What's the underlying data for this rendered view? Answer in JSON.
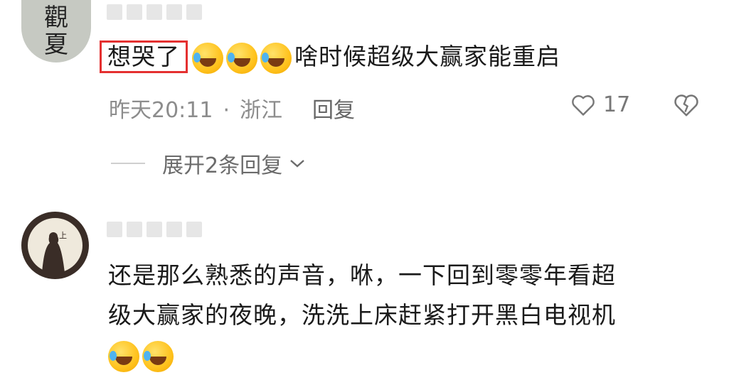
{
  "comments": [
    {
      "avatar_text": "觀夏",
      "highlighted_text": "想哭了",
      "emoji_count": 3,
      "emoji_name": "laughing-crying-emoji",
      "text": "啥时候超级大赢家能重启",
      "time": "昨天20:11",
      "location": "浙江",
      "reply_label": "回复",
      "like_count": "17",
      "expand_label": "展开2条回复"
    },
    {
      "text_line1": "还是那么熟悉的声音，咻，一下回到零零年看超",
      "text_line2": "级大赢家的夜晚，洗洗上床赶紧打开黑白电视机",
      "emoji_count": 2,
      "emoji_name": "crying-emoji"
    }
  ],
  "colors": {
    "highlight_border": "#e43030",
    "meta_text": "#8c8c8c"
  }
}
